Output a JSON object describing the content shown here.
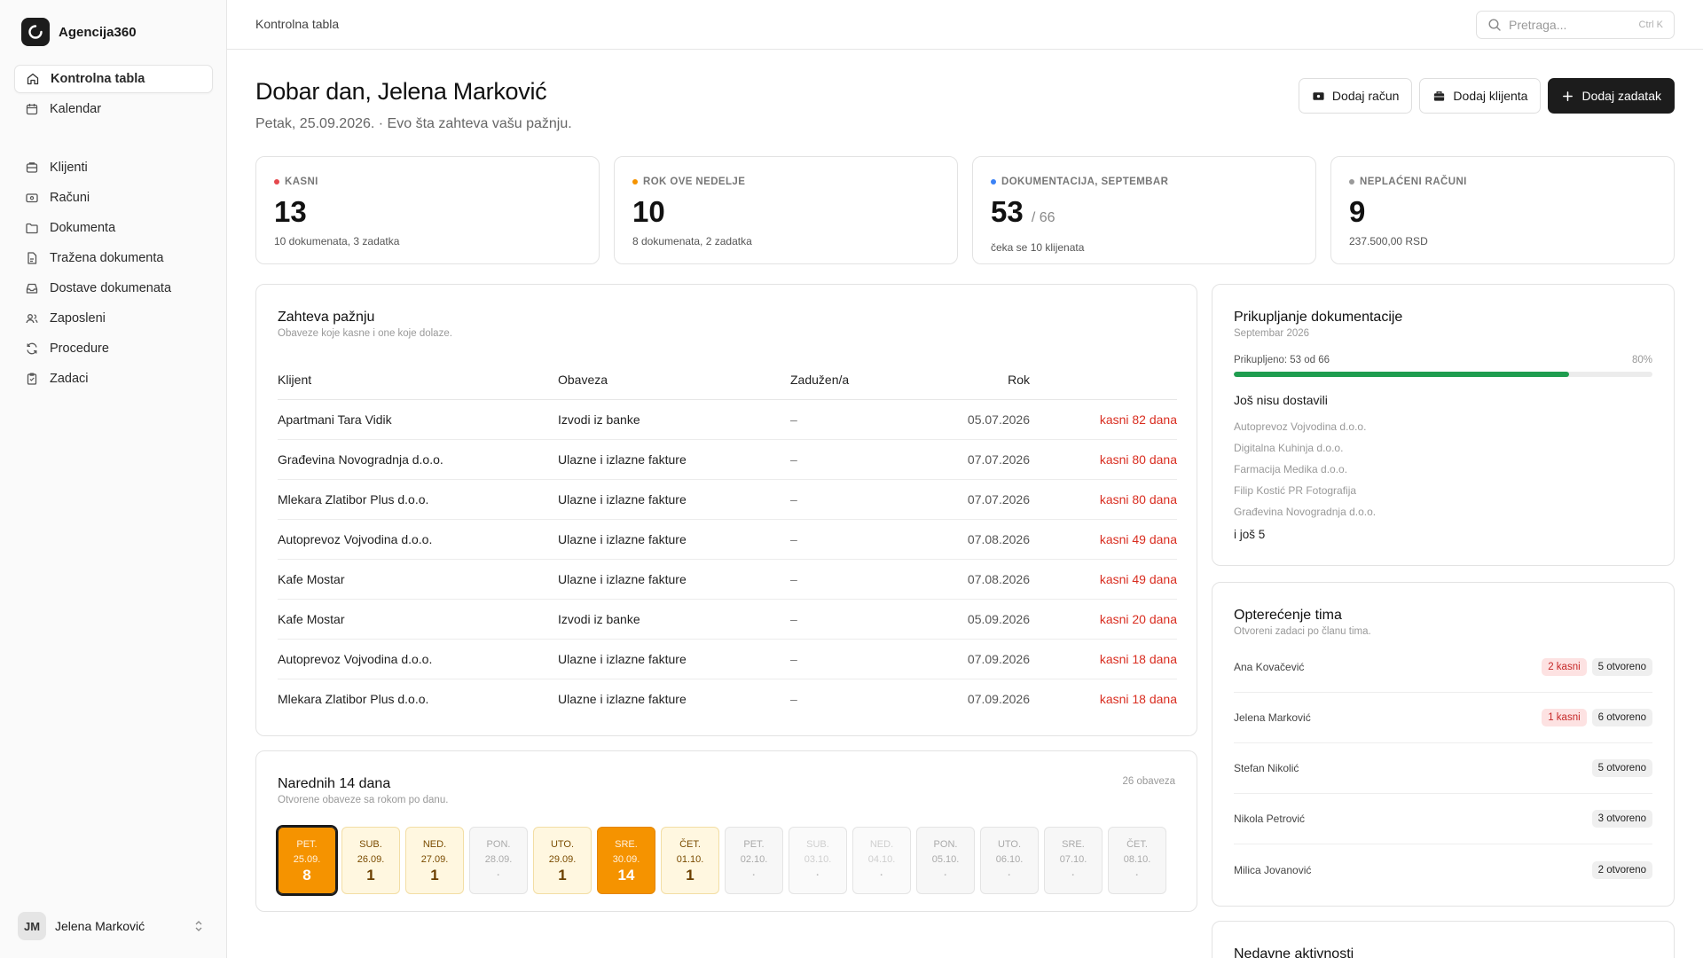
{
  "app": {
    "name": "Agencija360"
  },
  "sidebar": {
    "items_top": [
      {
        "label": "Kontrolna tabla",
        "icon": "home-icon"
      },
      {
        "label": "Kalendar",
        "icon": "calendar-icon"
      }
    ],
    "items_main": [
      {
        "label": "Klijenti",
        "icon": "clients-icon"
      },
      {
        "label": "Računi",
        "icon": "invoice-icon"
      },
      {
        "label": "Dokumenta",
        "icon": "folder-icon"
      },
      {
        "label": "Tražena dokumenta",
        "icon": "file-request-icon"
      },
      {
        "label": "Dostave dokumenata",
        "icon": "inbox-icon"
      },
      {
        "label": "Zaposleni",
        "icon": "users-icon"
      },
      {
        "label": "Procedure",
        "icon": "refresh-icon"
      },
      {
        "label": "Zadaci",
        "icon": "clipboard-icon"
      }
    ],
    "user": {
      "initials": "JM",
      "name": "Jelena Marković"
    }
  },
  "topbar": {
    "breadcrumb": "Kontrolna tabla",
    "search_placeholder": "Pretraga...",
    "search_shortcut": "Ctrl K"
  },
  "header": {
    "greeting": "Dobar dan, Jelena Marković",
    "subline": "Petak, 25.09.2026. · Evo šta zahteva vašu pažnju.",
    "buttons": {
      "add_invoice": "Dodaj račun",
      "add_client": "Dodaj klijenta",
      "add_task": "Dodaj zadatak"
    }
  },
  "stats": {
    "late": {
      "label": "KASNI",
      "value": "13",
      "sub": "10 dokumenata, 3 zadatka",
      "color": "#e5484d"
    },
    "due_week": {
      "label": "ROK OVE NEDELJE",
      "value": "10",
      "sub": "8 dokumenata, 2 zadatka",
      "color": "#f59300"
    },
    "docs": {
      "label": "DOKUMENTACIJA, SEPTEMBAR",
      "value": "53",
      "of": "/ 66",
      "sub": "čeka se 10 klijenata",
      "color": "#3b82f6"
    },
    "unpaid": {
      "label": "NEPLAĆENI RAČUNI",
      "value": "9",
      "sub": "237.500,00 RSD",
      "color": "#9a9a9a"
    }
  },
  "attention": {
    "title": "Zahteva pažnju",
    "subtitle": "Obaveze koje kasne i one koje dolaze.",
    "columns": {
      "client": "Klijent",
      "obligation": "Obaveza",
      "assignee": "Zadužen/a",
      "due": "Rok"
    },
    "rows": [
      {
        "client": "Apartmani Tara Vidik",
        "obligation": "Izvodi iz banke",
        "assignee": "–",
        "due": "05.07.2026",
        "status": "kasni 82 dana"
      },
      {
        "client": "Građevina Novogradnja d.o.o.",
        "obligation": "Ulazne i izlazne fakture",
        "assignee": "–",
        "due": "07.07.2026",
        "status": "kasni 80 dana"
      },
      {
        "client": "Mlekara Zlatibor Plus d.o.o.",
        "obligation": "Ulazne i izlazne fakture",
        "assignee": "–",
        "due": "07.07.2026",
        "status": "kasni 80 dana"
      },
      {
        "client": "Autoprevoz Vojvodina d.o.o.",
        "obligation": "Ulazne i izlazne fakture",
        "assignee": "–",
        "due": "07.08.2026",
        "status": "kasni 49 dana"
      },
      {
        "client": "Kafe Mostar",
        "obligation": "Ulazne i izlazne fakture",
        "assignee": "–",
        "due": "07.08.2026",
        "status": "kasni 49 dana"
      },
      {
        "client": "Kafe Mostar",
        "obligation": "Izvodi iz banke",
        "assignee": "–",
        "due": "05.09.2026",
        "status": "kasni 20 dana"
      },
      {
        "client": "Autoprevoz Vojvodina d.o.o.",
        "obligation": "Ulazne i izlazne fakture",
        "assignee": "–",
        "due": "07.09.2026",
        "status": "kasni 18 dana"
      },
      {
        "client": "Mlekara Zlatibor Plus d.o.o.",
        "obligation": "Ulazne i izlazne fakture",
        "assignee": "–",
        "due": "07.09.2026",
        "status": "kasni 18 dana"
      }
    ]
  },
  "next14": {
    "title": "Narednih 14 dana",
    "subtitle": "Otvorene obaveze sa rokom po danu.",
    "count": "26 obaveza",
    "days": [
      {
        "name": "PET.",
        "date": "25.09.",
        "count": "8",
        "level": "strong",
        "selected": true
      },
      {
        "name": "SUB.",
        "date": "26.09.",
        "count": "1",
        "level": "light"
      },
      {
        "name": "NED.",
        "date": "27.09.",
        "count": "1",
        "level": "light"
      },
      {
        "name": "PON.",
        "date": "28.09.",
        "count": "·",
        "level": "none"
      },
      {
        "name": "UTO.",
        "date": "29.09.",
        "count": "1",
        "level": "light"
      },
      {
        "name": "SRE.",
        "date": "30.09.",
        "count": "14",
        "level": "strong"
      },
      {
        "name": "ČET.",
        "date": "01.10.",
        "count": "1",
        "level": "light"
      },
      {
        "name": "PET.",
        "date": "02.10.",
        "count": "·",
        "level": "none"
      },
      {
        "name": "SUB.",
        "date": "03.10.",
        "count": "·",
        "level": "weekend"
      },
      {
        "name": "NED.",
        "date": "04.10.",
        "count": "·",
        "level": "weekend"
      },
      {
        "name": "PON.",
        "date": "05.10.",
        "count": "·",
        "level": "none"
      },
      {
        "name": "UTO.",
        "date": "06.10.",
        "count": "·",
        "level": "none"
      },
      {
        "name": "SRE.",
        "date": "07.10.",
        "count": "·",
        "level": "none"
      },
      {
        "name": "ČET.",
        "date": "08.10.",
        "count": "·",
        "level": "none"
      }
    ]
  },
  "docs_collection": {
    "title": "Prikupljanje dokumentacije",
    "subtitle": "Septembar 2026",
    "progress_label": "Prikupljeno: 53 od 66",
    "progress_percent": "80%",
    "progress_value": 0.8,
    "missing_title": "Još nisu dostavili",
    "missing": [
      "Autoprevoz Vojvodina d.o.o.",
      "Digitalna Kuhinja d.o.o.",
      "Farmacija Medika d.o.o.",
      "Filip Kostić PR Fotografija",
      "Građevina Novogradnja d.o.o."
    ],
    "more": "i još 5"
  },
  "team_load": {
    "title": "Opterećenje tima",
    "subtitle": "Otvoreni zadaci po članu tima.",
    "members": [
      {
        "name": "Ana Kovačević",
        "late": "2 kasni",
        "open": "5 otvoreno"
      },
      {
        "name": "Jelena Marković",
        "late": "1 kasni",
        "open": "6 otvoreno"
      },
      {
        "name": "Stefan Nikolić",
        "late": "",
        "open": "5 otvoreno"
      },
      {
        "name": "Nikola Petrović",
        "late": "",
        "open": "3 otvoreno"
      },
      {
        "name": "Milica Jovanović",
        "late": "",
        "open": "2 otvoreno"
      }
    ]
  },
  "recent": {
    "title": "Nedavne aktivnosti"
  }
}
